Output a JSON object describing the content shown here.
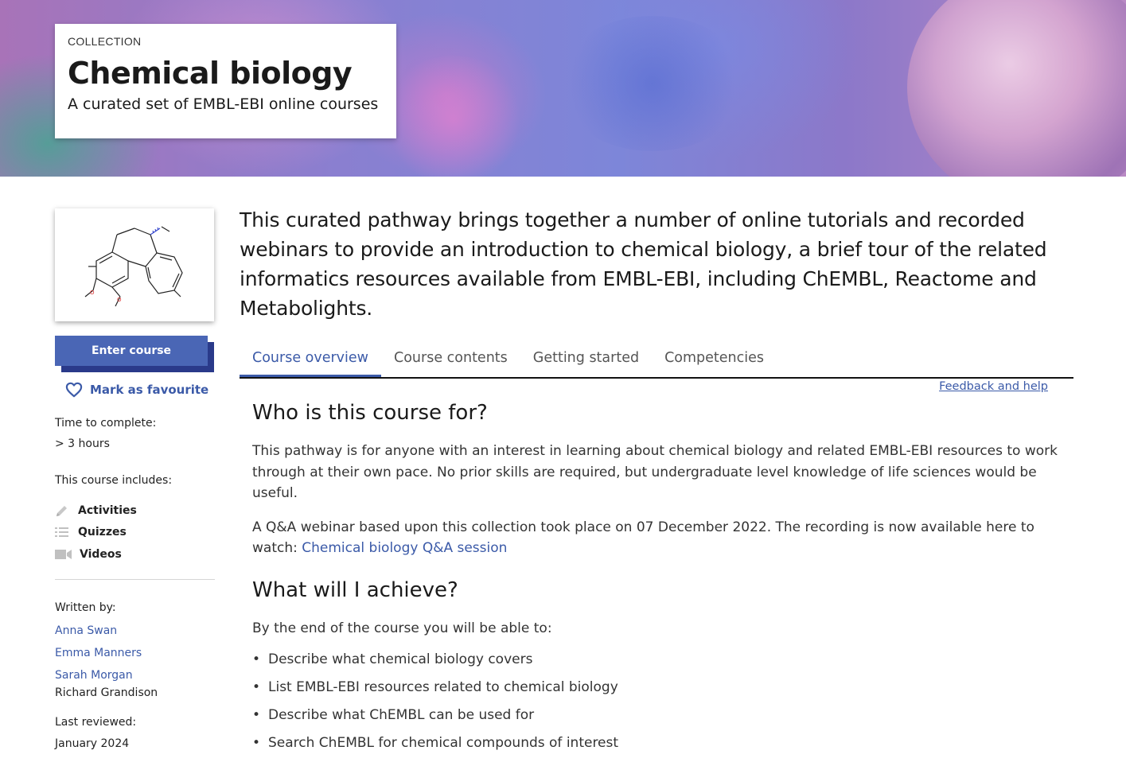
{
  "hero": {
    "eyebrow": "COLLECTION",
    "title": "Chemical biology",
    "subtitle": "A curated set of EMBL-EBI online courses"
  },
  "sidebar": {
    "enter_label": "Enter course",
    "favourite_label": "Mark as favourite",
    "time_label": "Time to complete:",
    "time_value": "> 3 hours",
    "includes_label": "This course includes:",
    "includes": [
      {
        "label": "Activities",
        "icon": "pencil-icon"
      },
      {
        "label": "Quizzes",
        "icon": "list-icon"
      },
      {
        "label": "Videos",
        "icon": "video-camera-icon"
      }
    ],
    "written_by_label": "Written by:",
    "authors": [
      "Anna Swan",
      "Emma Manners",
      "Sarah Morgan",
      "Richard Grandison"
    ],
    "reviewed_label": "Last reviewed:",
    "reviewed_value": "January 2024"
  },
  "main": {
    "intro": "This curated pathway brings together a number of online tutorials and recorded webinars to provide an introduction to chemical biology, a brief tour of the related informatics resources available from EMBL-EBI, including ChEMBL, Reactome and Metabolights.",
    "tabs": [
      {
        "label": "Course overview",
        "active": true
      },
      {
        "label": "Course contents",
        "active": false
      },
      {
        "label": "Getting started",
        "active": false
      },
      {
        "label": "Competencies",
        "active": false
      }
    ],
    "feedback_label": "Feedback and help",
    "section1_title": "Who is this course for?",
    "section1_para1": "This pathway is for anyone with an interest in learning about chemical biology and related EMBL-EBI resources to work through at their own pace. No prior skills are required, but undergraduate level knowledge of life sciences would be useful.",
    "section1_para2_prefix": "A Q&A webinar based upon this collection took place on 07 December 2022. The recording is now available here to watch: ",
    "section1_link": "Chemical biology Q&A session",
    "section2_title": "What will I achieve?",
    "section2_intro": "By the end of the course you will be able to:",
    "goals": [
      "Describe what chemical biology covers",
      "List EMBL-EBI resources related to chemical biology",
      "Describe what ChEMBL can be used for",
      "Search ChEMBL for chemical compounds of interest"
    ]
  },
  "colors": {
    "accent": "#3b5aa8",
    "button": "#4a66b5",
    "button_shadow": "#2a3a8a"
  }
}
